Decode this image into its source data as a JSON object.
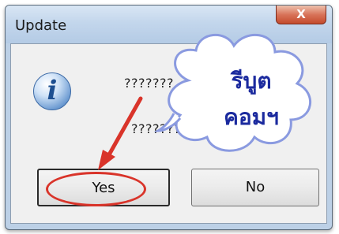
{
  "dialog": {
    "title": "Update",
    "close_symbol": "X",
    "icon": "info-icon",
    "message_line1": "???????",
    "message_line2": "???????",
    "yes_label": "Yes",
    "no_label": "No"
  },
  "annotation": {
    "cloud_text_line1": "รีบูต",
    "cloud_text_line2": "คอมฯ",
    "arrow_color": "#d9342a",
    "cloud_border_color": "#8a9ae0",
    "text_color": "#1b2a9e"
  }
}
